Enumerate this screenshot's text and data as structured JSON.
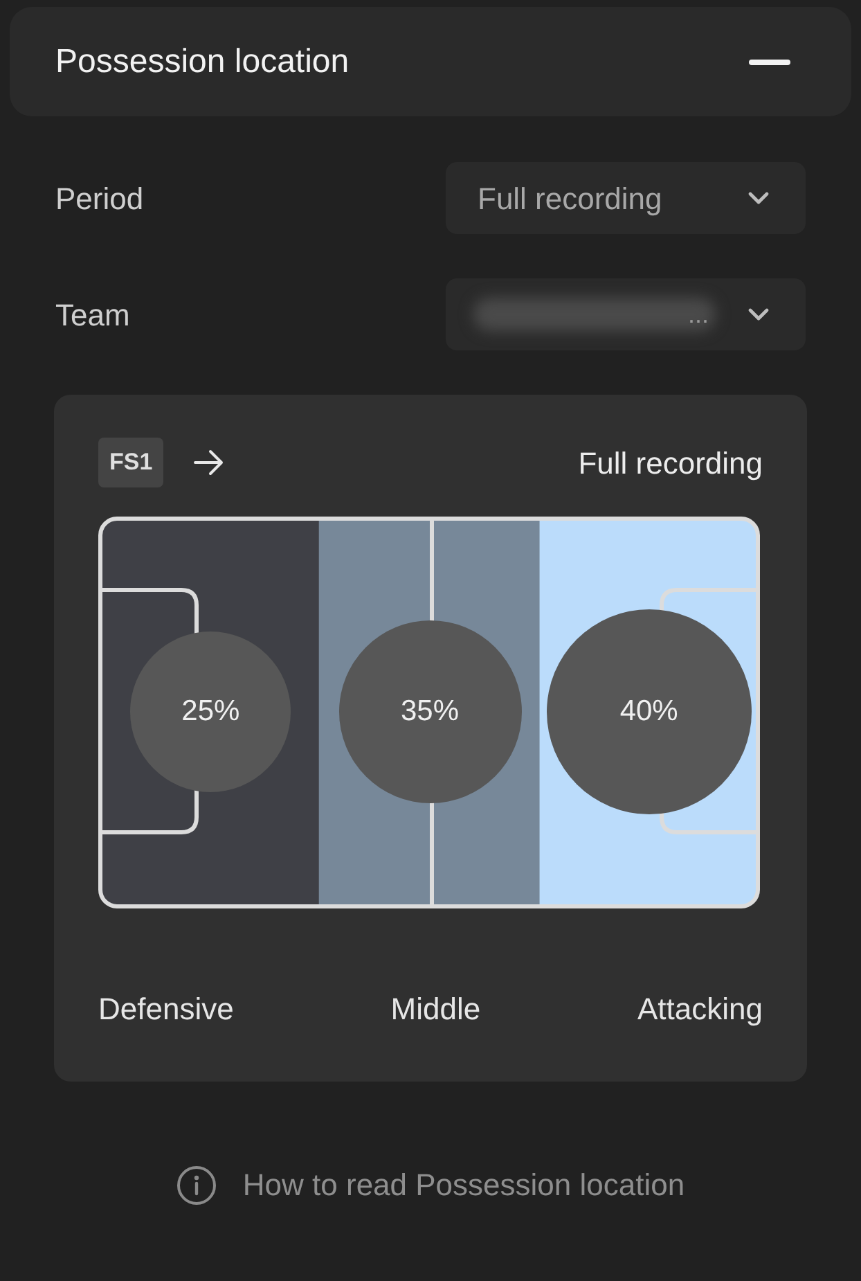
{
  "panel": {
    "title": "Possession location",
    "expanded": true
  },
  "filters": [
    {
      "label": "Period",
      "value": "Full recording"
    },
    {
      "label": "Team",
      "value": "...",
      "blurred": true
    }
  ],
  "card": {
    "badge": "FS1",
    "period": "Full recording",
    "zones": [
      {
        "name": "Defensive",
        "share": "25%",
        "color": "#3f4046"
      },
      {
        "name": "Middle",
        "share": "35%",
        "color": "#778899"
      },
      {
        "name": "Attacking",
        "share": "40%",
        "color": "#bbdcfb"
      }
    ]
  },
  "help_link": "How to read Possession location"
}
